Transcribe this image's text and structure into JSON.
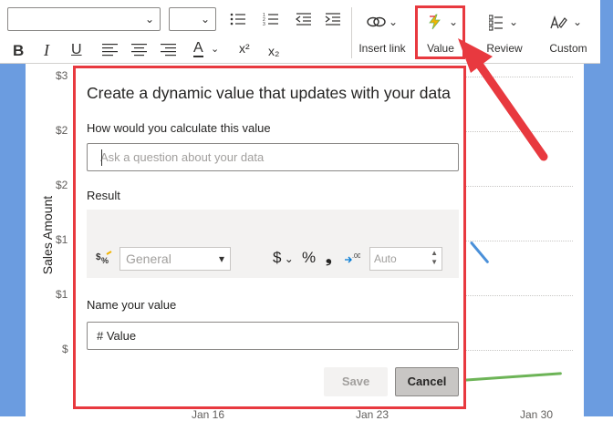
{
  "ribbon": {
    "font_name": "",
    "font_size": "",
    "insert_link_label": "Insert link",
    "value_label": "Value",
    "review_label": "Review",
    "custom_label": "Custom",
    "superscript": "x²",
    "subscript": "x₂",
    "font_color_letter": "A",
    "highlight_color": "#e8393f"
  },
  "chart": {
    "y_axis_label": "Sales Amount",
    "y_ticks": [
      "$3",
      "$2",
      "$2",
      "$1",
      "$1",
      "$"
    ],
    "x_ticks": [
      "Jan 16",
      "Jan 23",
      "Jan 30"
    ],
    "series_colors": [
      "#4a90d9",
      "#6db457"
    ]
  },
  "dialog": {
    "title": "Create a dynamic value that updates with your data",
    "question_label": "How would you calculate this value",
    "question_placeholder": "Ask a question about your data",
    "result_label": "Result",
    "format_dropdown_value": "General",
    "currency_symbol": "$",
    "percent_symbol": "%",
    "comma_symbol": "❟",
    "decimal_placeholder": "Auto",
    "name_label": "Name your value",
    "name_value": "# Value",
    "save_label": "Save",
    "cancel_label": "Cancel"
  }
}
